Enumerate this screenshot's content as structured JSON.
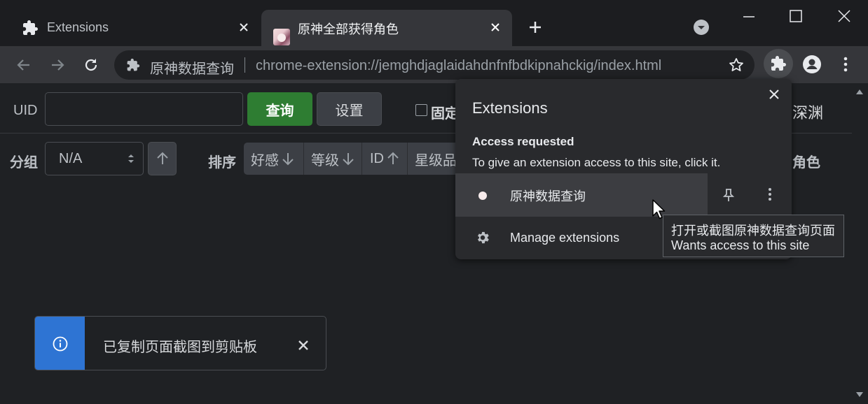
{
  "tabs": [
    {
      "title": "Extensions",
      "icon": "puzzle-icon"
    },
    {
      "title": "原神全部获得角色",
      "icon": "character-favicon"
    }
  ],
  "toolbar": {
    "site_name": "原神数据查询",
    "url": "chrome-extension://jemghdjaglaidahdnfnfbdkipnahckig/index.html"
  },
  "page": {
    "uid_label": "UID",
    "uid_value": "",
    "query_button": "查询",
    "settings_button": "设置",
    "pin_label": "固定",
    "abyss_label": "深渊",
    "group_label": "分组",
    "group_select_value": "N/A",
    "sort_label": "排序",
    "sort_options": [
      "好感",
      "等级",
      "ID",
      "星级品"
    ],
    "characters_label": "角色",
    "colors": {
      "query_green": "#2e7d32",
      "toast_blue": "#2e74d3"
    }
  },
  "ext_popup": {
    "title": "Extensions",
    "access_heading": "Access requested",
    "access_desc": "To give an extension access to this site, click it.",
    "extension_name": "原神数据查询",
    "manage_label": "Manage extensions"
  },
  "tooltip": {
    "line1": "打开或截图原神数据查询页面",
    "line2": "Wants access to this site"
  },
  "toast": {
    "message": "已复制页面截图到剪贴板"
  }
}
